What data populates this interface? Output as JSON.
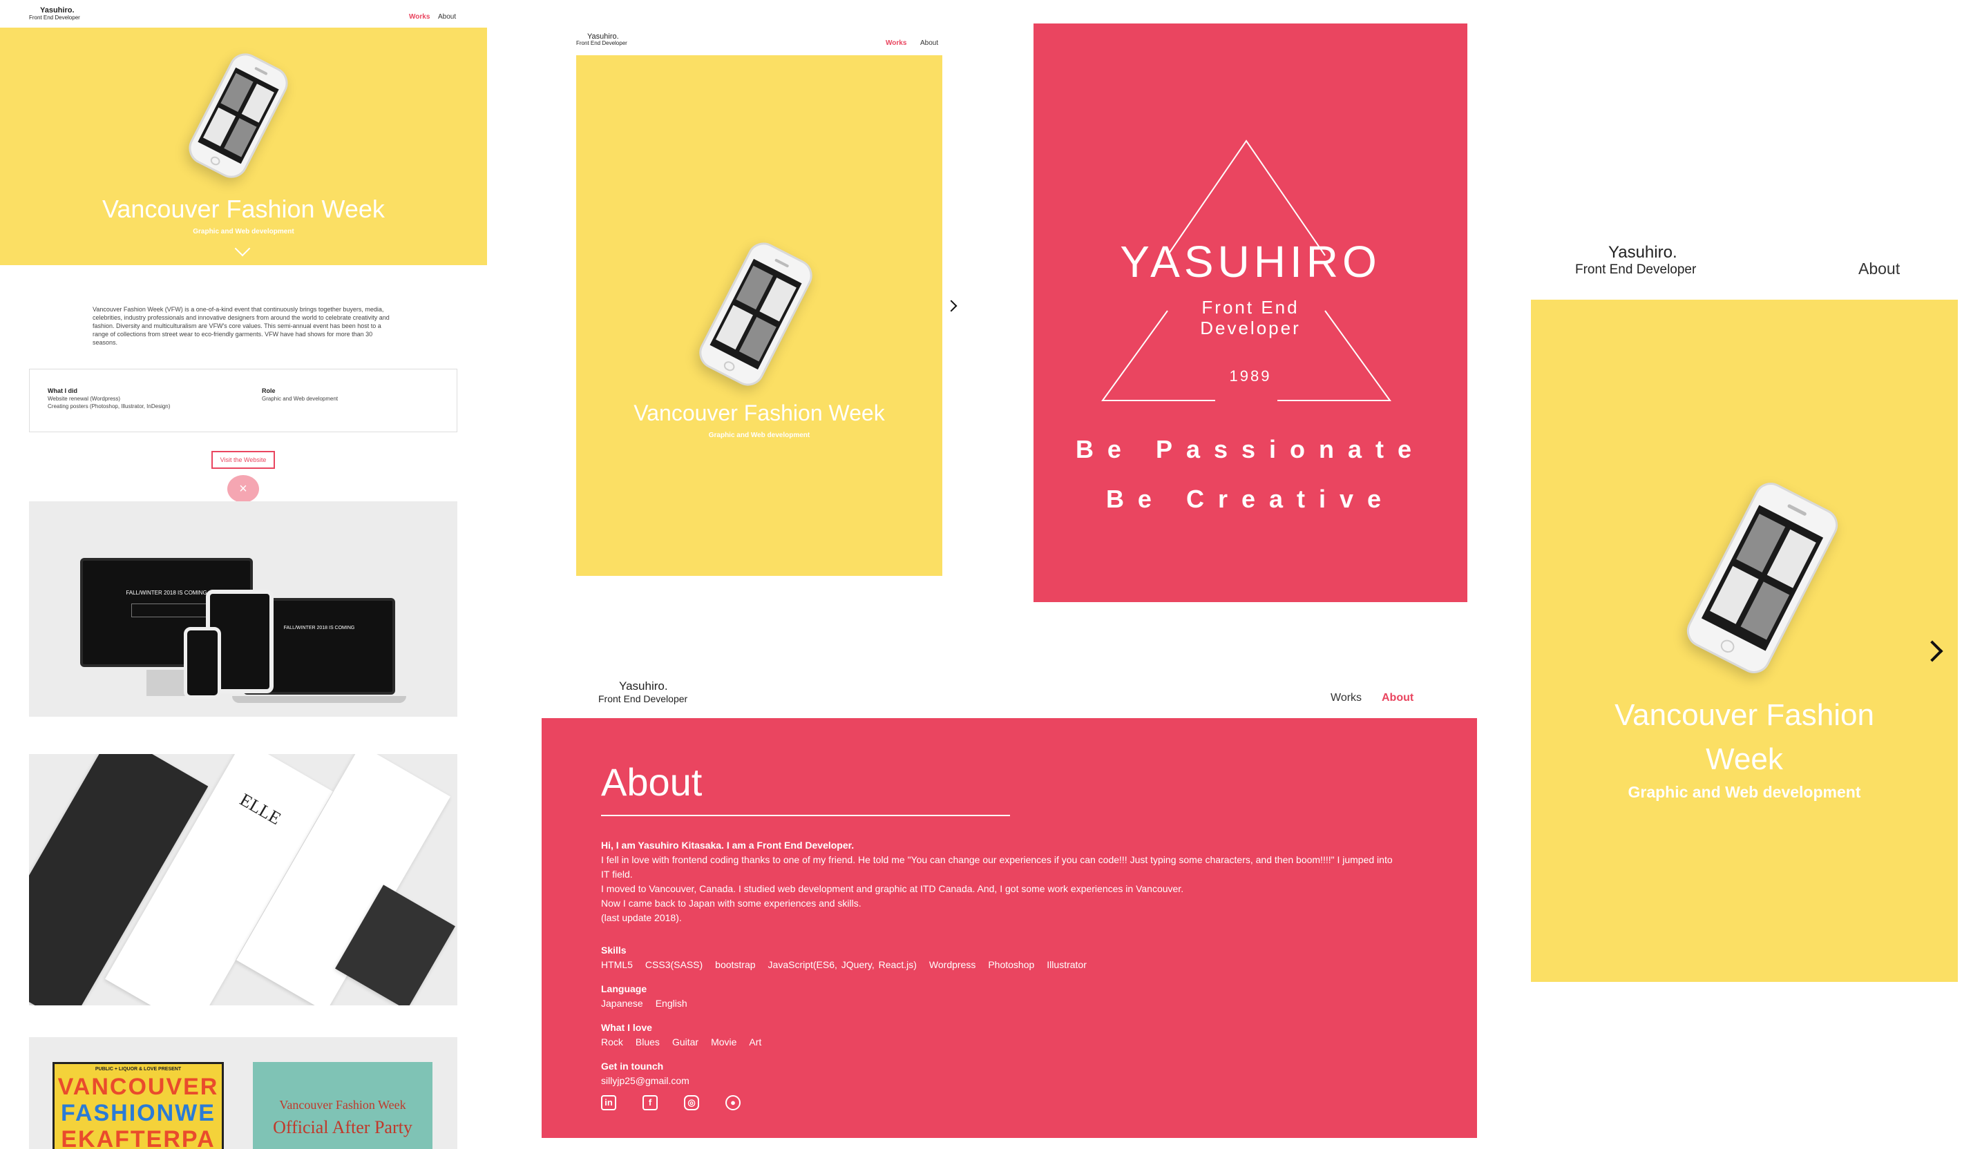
{
  "brand": {
    "name": "Yasuhiro.",
    "tagline": "Front End Developer"
  },
  "nav": {
    "works": "Works",
    "about": "About"
  },
  "project": {
    "title": "Vancouver Fashion Week",
    "subtitle": "Graphic and Web development",
    "description": "Vancouver Fashion Week (VFW) is a one-of-a-kind event that continuously brings together buyers, media, celebrities, industry professionals and innovative designers from around the world to celebrate creativity and fashion. Diversity and multiculturalism are VFW's core values. This semi-annual event has been host to a range of collections from street wear to eco-friendly garments. VFW have had shows for more than 30 seasons.",
    "what_i_did_label": "What I did",
    "what_i_did_1": "Website renewal (Wordpress)",
    "what_i_did_2": "Creating posters (Photoshop, Illustrator, InDesign)",
    "role_label": "Role",
    "role_value": "Graphic and Web development",
    "visit_button": "Visit the Website",
    "close_symbol": "×",
    "mockup_banner": "FALL/WINTER 2018 IS COMING",
    "elle": "ELLE",
    "poster1_top": "PUBLIC + LIQUOR & LOVE PRESENT",
    "poster1_line1": "VANCOUVER",
    "poster1_line2": "FASHIONWE",
    "poster1_line3": "EKAFTERPA",
    "poster2_line1": "Vancouver Fashion Week",
    "poster2_line2": "Official After Party"
  },
  "logo": {
    "name": "YASUHIRO",
    "role_line1": "Front End",
    "role_line2": "Developer",
    "year": "1989",
    "slogan1": "Be Passionate",
    "slogan2": "Be Creative"
  },
  "about": {
    "heading": "About",
    "intro": "Hi, I am Yasuhiro Kitasaka. I am a Front End Developer.",
    "p1": "I fell in love with frontend coding thanks to one of my friend. He told me \"You can change our experiences if you can code!!! Just typing some characters, and then boom!!!!\" I jumped into IT field.",
    "p2": "I moved to Vancouver, Canada. I studied web development and graphic at ITD Canada. And, I got some work experiences in Vancouver.",
    "p3": "Now I came back to Japan with some experiences and skills.",
    "p4": "(last update 2018).",
    "skills_label": "Skills",
    "skills": [
      "HTML5",
      "CSS3(SASS)",
      "bootstrap",
      "JavaScript(ES6, JQuery, React.js)",
      "Wordpress",
      "Photoshop",
      "Illustrator"
    ],
    "language_label": "Language",
    "languages": [
      "Japanese",
      "English"
    ],
    "love_label": "What I love",
    "loves": [
      "Rock",
      "Blues",
      "Guitar",
      "Movie",
      "Art"
    ],
    "contact_label": "Get in tounch",
    "email": "sillyjp25@gmail.com",
    "social_icons": [
      "linkedin-icon",
      "facebook-icon",
      "instagram-icon",
      "github-icon"
    ]
  },
  "colors": {
    "yellow": "#fbdf64",
    "red": "#ea4560",
    "accent": "#e9455f"
  }
}
